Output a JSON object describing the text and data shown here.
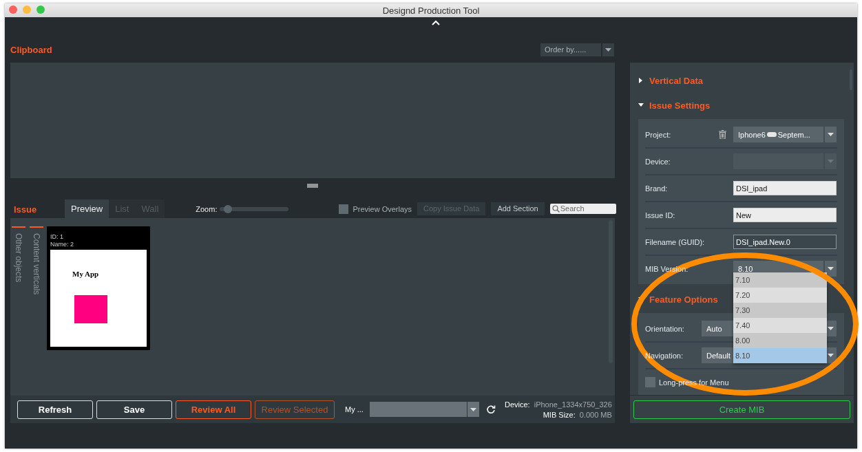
{
  "window": {
    "title": "Designd Production Tool"
  },
  "clipboard": {
    "title": "Clipboard",
    "order_by": "Order by......"
  },
  "issue": {
    "title": "Issue",
    "tabs": [
      {
        "label": "Preview",
        "selected": true
      },
      {
        "label": "List",
        "selected": false
      },
      {
        "label": "Wall",
        "selected": false
      }
    ],
    "zoom": {
      "label": "Zoom:",
      "level": 0.12
    },
    "preview_overlays": {
      "label": "Preview Overlays",
      "checked": false
    },
    "buttons": [
      {
        "label": "Copy Issue Data",
        "disabled": true
      },
      {
        "label": "Add Section",
        "disabled": false
      }
    ],
    "search": {
      "placeholder": "Search"
    },
    "side_tabs": [
      "Other objects",
      "Content verticals"
    ],
    "pages": [
      {
        "id": "ID: 1",
        "name": "Name: 2",
        "screen_title": "My App",
        "color": "#ff0080"
      }
    ]
  },
  "footer": {
    "buttons": [
      {
        "label": "Refresh",
        "kind": "plain",
        "disabled": false
      },
      {
        "label": "Save",
        "kind": "plain",
        "disabled": false
      },
      {
        "label": "Review All",
        "kind": "accent",
        "disabled": false
      },
      {
        "label": "Review Selected",
        "kind": "accent",
        "disabled": true
      }
    ],
    "publication_label": "My ...",
    "device_label": "Device:",
    "device": "iPhone_1334x750_326",
    "size_label": "MIB Size:",
    "size": "0.000 MB"
  },
  "sidebar": {
    "sections": [
      {
        "title": "Vertical Data",
        "expanded": false
      },
      {
        "title": "Issue Settings",
        "expanded": true,
        "fields": [
          {
            "kind": "select",
            "label": "Project:",
            "value": "Iphone6",
            "value_suffix": "Septem...",
            "deletable": true,
            "disabled": false
          },
          {
            "kind": "select",
            "label": "Device:",
            "disabled": true
          },
          {
            "kind": "input",
            "label": "Brand:",
            "value": "DSI_ipad"
          },
          {
            "kind": "input",
            "label": "Issue ID:",
            "value": "New"
          },
          {
            "kind": "readonly",
            "label": "Filename (GUID):",
            "value": "DSI_ipad.New.0"
          },
          {
            "kind": "select",
            "label": "MIB Version:",
            "value": "8.10",
            "disabled": false
          }
        ]
      },
      {
        "title": "Feature Options",
        "expanded": true,
        "fields": [
          {
            "kind": "select",
            "label": "Orientation:",
            "value": "Auto",
            "disabled": false
          },
          {
            "kind": "select",
            "label": "Navigation:",
            "value": "Default",
            "disabled": false
          },
          {
            "kind": "checkbox",
            "label": "Long-press for Menu",
            "checked": false
          }
        ]
      }
    ]
  },
  "mib_dropdown": {
    "options": [
      {
        "label": "7.10",
        "selected": false
      },
      {
        "label": "7.20",
        "selected": false
      },
      {
        "label": "7.30",
        "selected": false
      },
      {
        "label": "7.40",
        "selected": false
      },
      {
        "label": "8.00",
        "selected": false
      },
      {
        "label": "8.10",
        "selected": true
      }
    ]
  },
  "create_button": {
    "label": "Create MIB"
  }
}
